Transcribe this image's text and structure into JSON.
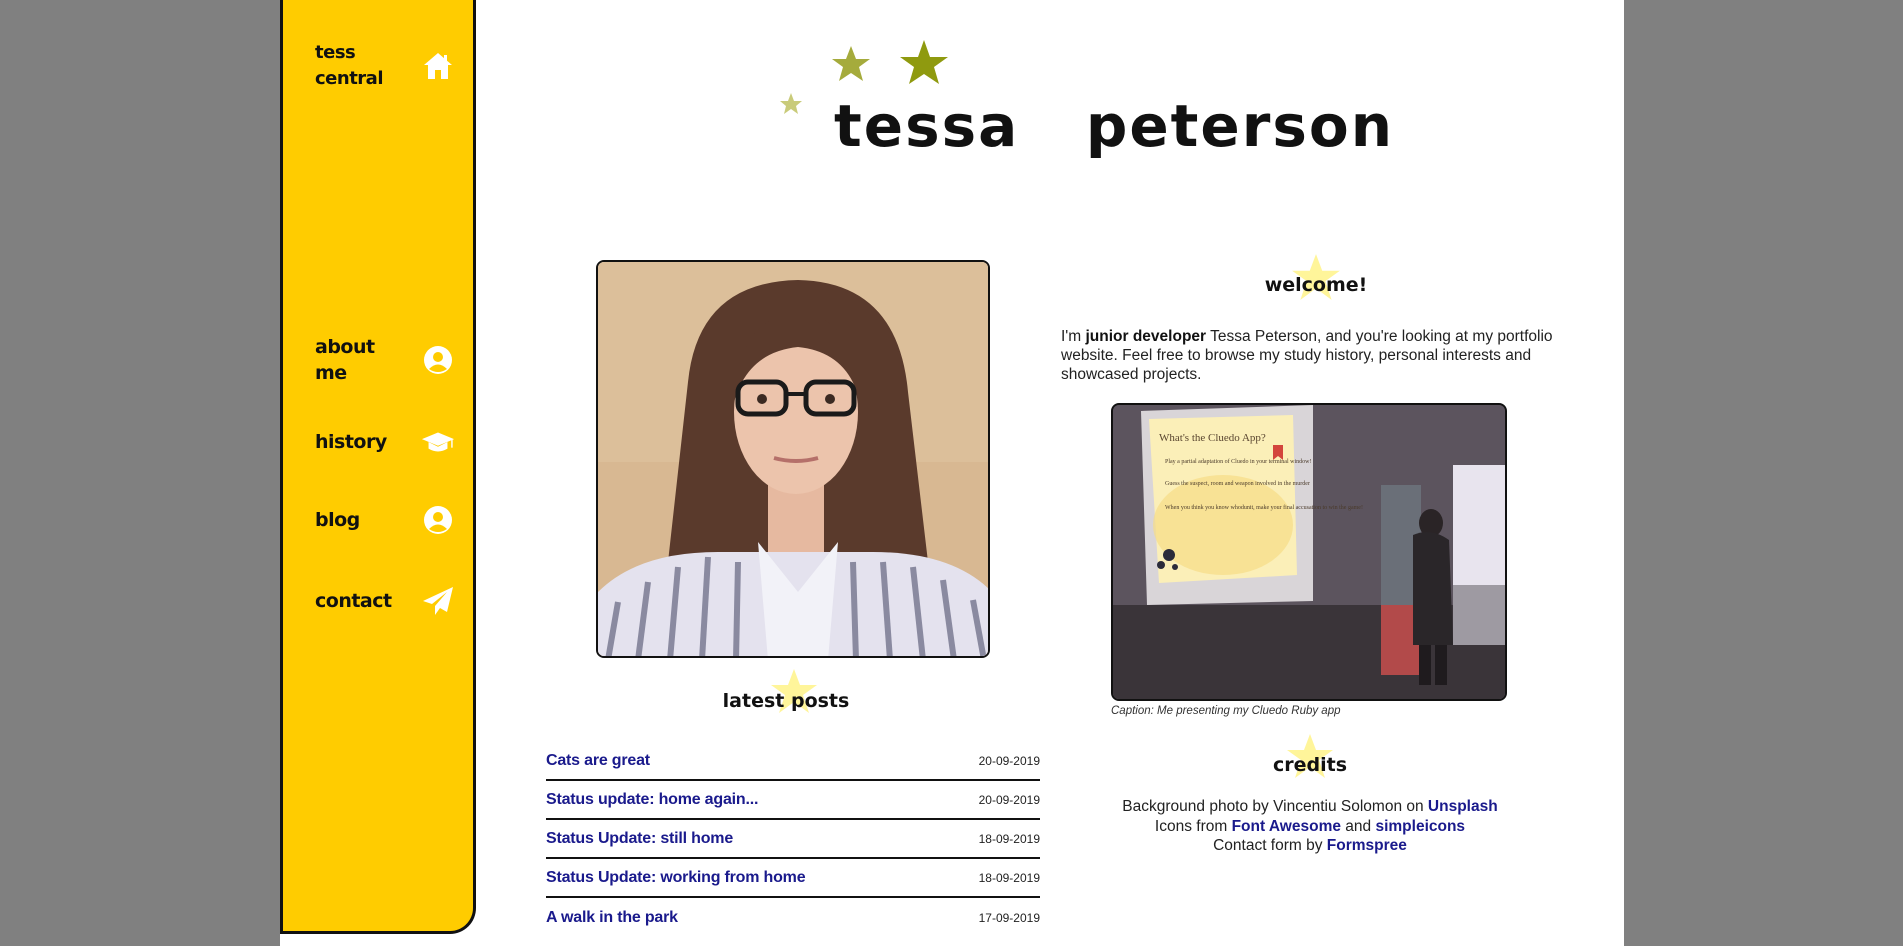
{
  "sidebar": {
    "home": "tess central",
    "items": [
      {
        "label": "about me",
        "icon": "user-circle-icon"
      },
      {
        "label": "history",
        "icon": "graduation-cap-icon"
      },
      {
        "label": "blog",
        "icon": "user-circle-icon"
      },
      {
        "label": "contact",
        "icon": "paper-plane-icon"
      }
    ]
  },
  "header": {
    "title": "tessa   peterson"
  },
  "latest_posts": {
    "heading": "latest posts",
    "posts": [
      {
        "title": "Cats are great",
        "date": "20-09-2019"
      },
      {
        "title": "Status update: home again...",
        "date": "20-09-2019"
      },
      {
        "title": "Status Update: still home",
        "date": "18-09-2019"
      },
      {
        "title": "Status Update: working from home",
        "date": "18-09-2019"
      },
      {
        "title": "A walk in the park",
        "date": "17-09-2019"
      }
    ]
  },
  "welcome": {
    "heading": "welcome!",
    "intro_pre": "I'm ",
    "intro_bold": "junior developer",
    "intro_post": " Tessa Peterson, and you're looking at my portfolio website. Feel free to browse my study history, personal interests and showcased projects.",
    "caption": "Caption: Me presenting my Cluedo Ruby app",
    "slide_title": "What's the Cluedo App?",
    "slide_bullets": [
      "Play a partial adaptation of Cluedo in your terminal window!",
      "Guess the suspect, room and weapon involved in the murder",
      "When you think you know whodunit, make your final accusation to win the game!"
    ]
  },
  "credits": {
    "heading": "credits",
    "line1_pre": "Background photo by Vincentiu Solomon on ",
    "line1_link": "Unsplash",
    "line2_pre": "Icons from ",
    "line2_link1": "Font Awesome",
    "line2_mid": " and ",
    "line2_link2": "simpleicons",
    "line3_pre": "Contact form by ",
    "line3_link": "Formspree"
  },
  "colors": {
    "sidebar": "#ffcc00",
    "star_dark": "#8f9a0f",
    "star_mid": "#a5ab3c",
    "star_light": "#c9cb7a",
    "heading_star": "#fff59a",
    "link": "#1a1a8c",
    "page_bg": "#808080"
  }
}
